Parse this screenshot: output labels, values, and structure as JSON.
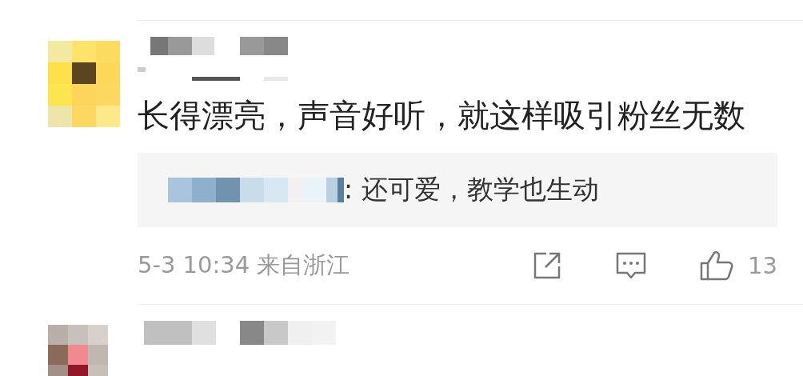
{
  "comments": [
    {
      "kind": "full",
      "text": "长得漂亮，声音好听，就这样吸引粉丝无数",
      "reply": {
        "text": ": 还可爱，教学也生动"
      },
      "time": "5-3 10:34 来自浙江",
      "likes": "13"
    },
    {
      "kind": "partial"
    }
  ]
}
